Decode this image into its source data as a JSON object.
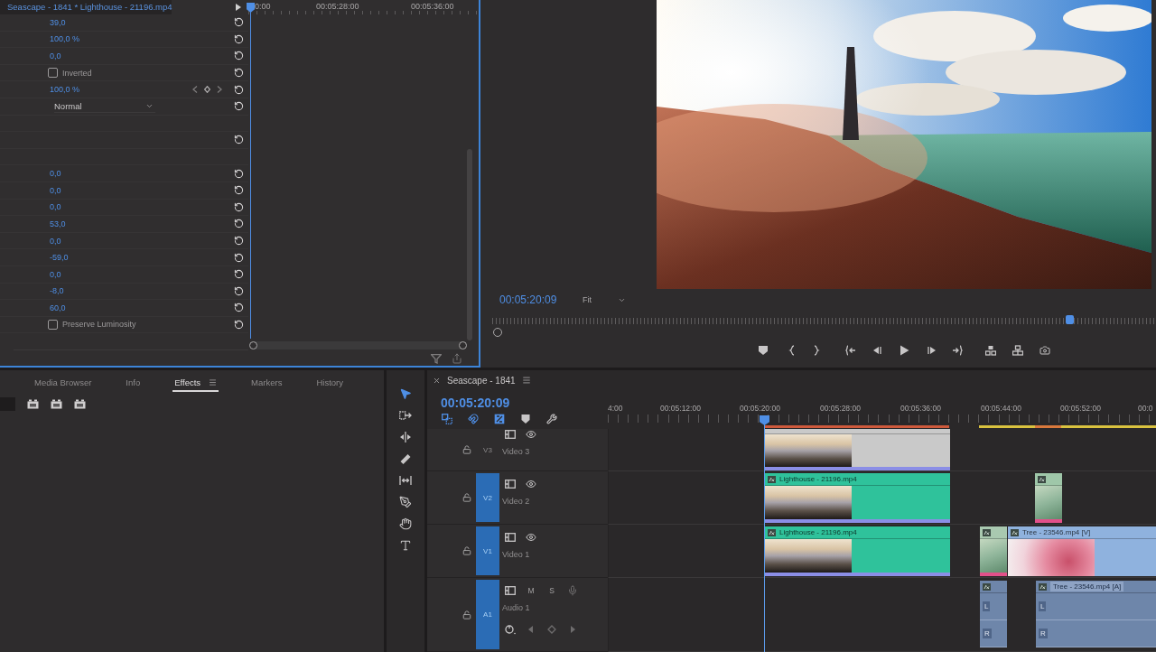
{
  "effect_controls": {
    "title": "Seascape - 1841 * Lighthouse - 21196.mp4",
    "ruler_labels": [
      "0:00",
      "00:05:28:00",
      "00:05:36:00"
    ],
    "rows": [
      {
        "kind": "value",
        "value": "39,0",
        "reset": true
      },
      {
        "kind": "value",
        "value": "100,0 %",
        "reset": true
      },
      {
        "kind": "value",
        "value": "0,0",
        "reset": true
      },
      {
        "kind": "checkbox",
        "label": "Inverted",
        "checked": false,
        "reset": true
      },
      {
        "kind": "value",
        "value": "100,0 %",
        "reset": true,
        "keyframe_nav": true
      },
      {
        "kind": "dropdown",
        "value": "Normal",
        "reset": true
      },
      {
        "kind": "blank",
        "reset": false
      },
      {
        "kind": "blank",
        "reset": true
      },
      {
        "kind": "blank",
        "reset": false
      },
      {
        "kind": "value",
        "value": "0,0",
        "reset": true
      },
      {
        "kind": "value",
        "value": "0,0",
        "reset": true
      },
      {
        "kind": "value",
        "value": "0,0",
        "reset": true
      },
      {
        "kind": "value",
        "value": "53,0",
        "reset": true
      },
      {
        "kind": "value",
        "value": "0,0",
        "reset": true
      },
      {
        "kind": "value",
        "value": "-59,0",
        "reset": true
      },
      {
        "kind": "value",
        "value": "0,0",
        "reset": true
      },
      {
        "kind": "value",
        "value": "-8,0",
        "reset": true
      },
      {
        "kind": "value",
        "value": "60,0",
        "reset": true
      },
      {
        "kind": "checkbox",
        "label": "Preserve Luminosity",
        "checked": false,
        "reset": true
      }
    ]
  },
  "program_monitor": {
    "timecode": "00:05:20:09",
    "zoom": "Fit",
    "scrubber": {
      "level": 0.87
    }
  },
  "panel_tabs": [
    {
      "label": "Media Browser",
      "selected": false
    },
    {
      "label": "Info",
      "selected": false
    },
    {
      "label": "Effects",
      "selected": true
    },
    {
      "label": "Markers",
      "selected": false
    },
    {
      "label": "History",
      "selected": false
    }
  ],
  "tools": [
    {
      "kind": "selection",
      "selected": true
    },
    {
      "kind": "track-select",
      "selected": false
    },
    {
      "kind": "ripple",
      "selected": false
    },
    {
      "kind": "razor",
      "selected": false
    },
    {
      "kind": "slip",
      "selected": false
    },
    {
      "kind": "pen",
      "selected": false
    },
    {
      "kind": "hand",
      "selected": false
    },
    {
      "kind": "type",
      "selected": false
    }
  ],
  "timeline": {
    "sequence": "Seascape - 1841",
    "timecode": "00:05:20:09",
    "ruler_labels": [
      "4:00",
      "00:05:12:00",
      "00:05:20:00",
      "00:05:28:00",
      "00:05:36:00",
      "00:05:44:00",
      "00:05:52:00",
      "00:0"
    ],
    "render_bars": [
      {
        "color": "#cf5a3c"
      },
      {
        "color": "#d9c23f"
      },
      {
        "color": "#d9793c"
      }
    ],
    "tracks": [
      {
        "kind": "video",
        "label": "V3",
        "name": "Video 3",
        "targeted": false,
        "clips": [
          {
            "kind": "video",
            "color": "#c9c9c9",
            "thumbnail": {
              "kind": "sunset"
            },
            "fx_stripe": true
          }
        ]
      },
      {
        "kind": "video",
        "label": "V2",
        "name": "Video 2",
        "targeted": true,
        "clips": [
          {
            "kind": "video",
            "label": "Lighthouse - 21196.mp4",
            "color": "#2fc29b",
            "thumbnail": {
              "kind": "sunset"
            },
            "fx_stripe": true
          },
          {
            "kind": "narrow",
            "color": "#9fc7a9",
            "thumbnail": {
              "kind": "leaves"
            }
          }
        ]
      },
      {
        "kind": "video",
        "label": "V1",
        "name": "Video 1",
        "targeted": true,
        "clips": [
          {
            "kind": "video",
            "label": "Lighthouse - 21196.mp4",
            "color": "#2fc29b",
            "thumbnail": {
              "kind": "sunset"
            },
            "fx_stripe": true
          },
          {
            "kind": "narrow",
            "color": "#a9c9b0",
            "thumbnail": {
              "kind": "leaves"
            }
          },
          {
            "kind": "video",
            "label": "Tree - 23546.mp4 [V]",
            "color": "#8fb2de",
            "thumbnail": {
              "kind": "blossom"
            },
            "fx_stripe": false
          }
        ]
      },
      {
        "kind": "audio",
        "label": "A1",
        "name": "Audio 1",
        "targeted": true,
        "buttons": [
          "M",
          "S"
        ],
        "clips": [
          {
            "kind": "audio",
            "color": "#6e86aa",
            "channels": [
              "L",
              "R"
            ]
          },
          {
            "kind": "audio",
            "label": "Tree - 23546.mp4 [A]",
            "color": "#6e86aa",
            "channels": [
              "L",
              "R"
            ]
          }
        ]
      }
    ]
  }
}
